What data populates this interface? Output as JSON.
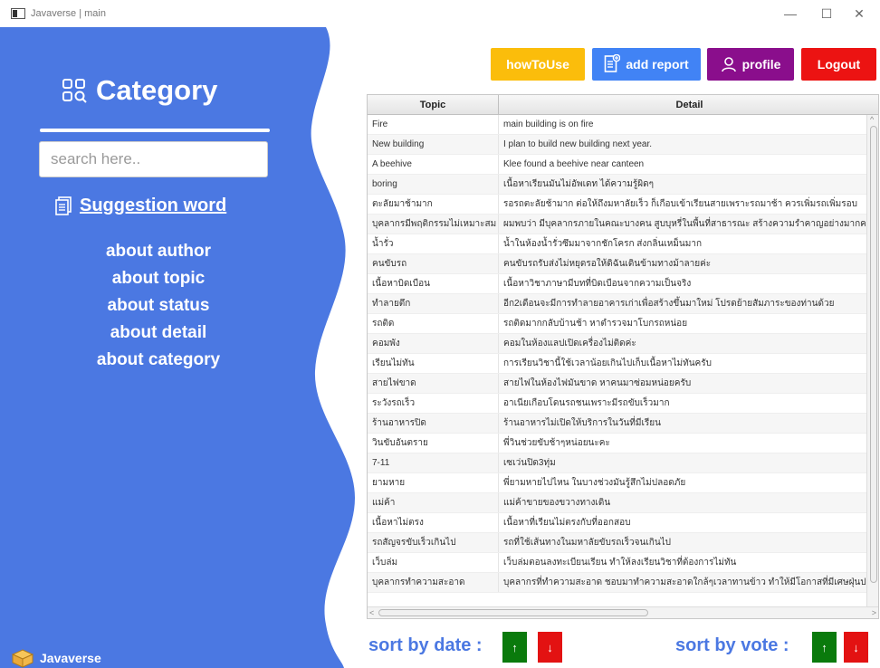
{
  "window": {
    "title": "Javaverse | main",
    "min_glyph": "—",
    "max_glyph": "☐",
    "close_glyph": "✕"
  },
  "sidebar": {
    "bg_color": "#4b78e2",
    "category_title": "Category",
    "search_placeholder": "search here..",
    "suggestion_title": "Suggestion word",
    "about_items": [
      "about author",
      "about topic",
      "about status",
      "about detail",
      "about category"
    ],
    "brand": "Javaverse"
  },
  "toolbar": {
    "howto_label": "howToUse",
    "add_report_label": "add report",
    "profile_label": "profile",
    "logout_label": "Logout",
    "colors": {
      "howto": "#fbbd0b",
      "add_report": "#4183f5",
      "profile": "#8a0e8c",
      "logout": "#ec1312"
    }
  },
  "table": {
    "headers": [
      "Topic",
      "Detail"
    ],
    "rows": [
      [
        "Fire",
        "main building is on fire"
      ],
      [
        "New building",
        "I plan to build new building next year."
      ],
      [
        "A beehive",
        "Klee found a beehive near canteen"
      ],
      [
        "boring",
        "เนื้อหาเรียนมันไม่อัพเดท ได้ความรู้ผิดๆ"
      ],
      [
        "ตะลัยมาช้ามาก",
        "รอรถตะลัยช้ามาก ต่อให้ถึงมหาลัยเร็ว ก็เกือบเข้าเรียนสายเพราะรถมาช้า ควรเพิ่มรถเพิ่มรอบ"
      ],
      [
        "บุคลากรมีพฤติกรรมไม่เหมาะสม",
        "ผมพบว่า มีบุคลากรภายในคณะบางคน สูบบุหรี่ในพื้นที่สาธารณะ สร้างความรำคาญอย่างมากครับ"
      ],
      [
        "น้ำรั่ว",
        "น้ำในห้องน้ำรั่วซึมมาจากชักโครก ส่งกลิ่นเหม็นมาก"
      ],
      [
        "คนขับรถ",
        "คนขับรถรับส่งไม่หยุดรอให้ดิฉันเดินข้ามทางม้าลายค่ะ"
      ],
      [
        "เนื้อหาบิดเบือน",
        "เนื้อหาวิชาภาษามีบทที่บิดเบือนจากความเป็นจริง"
      ],
      [
        "ทำลายตึก",
        "อีก2เดือนจะมีการทำลายอาคารเก่าเพื่อสร้างขึ้นมาใหม่ โปรดย้ายสัมภาระของท่านด้วย"
      ],
      [
        "รถติด",
        "รถติดมากกลับบ้านช้า หาตำรวจมาโบกรถหน่อย"
      ],
      [
        "คอมพัง",
        "คอมในห้องแลปเปิดเครื่องไม่ติดค่ะ"
      ],
      [
        "เรียนไม่ทัน",
        "การเรียนวิชานี้ใช้เวลาน้อยเกินไปเก็บเนื้อหาไม่ทันครับ"
      ],
      [
        "สายไฟขาด",
        "สายไฟในห้องไฟมันขาด หาคนมาซ่อมหน่อยครับ"
      ],
      [
        "ระวังรถเร็ว",
        "อาเนียเกือบโดนรถชนเพราะมีรถขับเร็วมาก"
      ],
      [
        "ร้านอาหารปิด",
        "ร้านอาหารไม่เปิดให้บริการในวันที่มีเรียน"
      ],
      [
        "วินขับอันตราย",
        "พี่วินช่วยขับช้าๆหน่อยนะคะ"
      ],
      [
        "7-11",
        "เซเว่นปิด3ทุ่ม"
      ],
      [
        "ยามหาย",
        "พี่ยามหายไปไหน ในบางช่วงมันรู้สึกไม่ปลอดภัย"
      ],
      [
        "แม่ค้า",
        "แม่ค้าขายของขวางทางเดิน"
      ],
      [
        "เนื้อหาไม่ตรง",
        "เนื้อหาที่เรียนไม่ตรงกับที่ออกสอบ"
      ],
      [
        "รถสัญจรขับเร็วเกินไป",
        "รถที่ใช้เส้นทางในมหาลัยขับรถเร็วจนเกินไป"
      ],
      [
        "เว็บล่ม",
        "เว็บล่มตอนลงทะเบียนเรียน ทำให้ลงเรียนวิชาที่ต้องการไม่ทัน"
      ],
      [
        "บุคลากรทำความสะอาด",
        "บุคลากรที่ทำความสะอาด ชอบมาทำความสะอาดใกล้ๆเวลาทานข้าว ทำให้มีโอกาสที่มีเศษฝุ่นปะปน"
      ]
    ]
  },
  "sort": {
    "date_label": "sort by date :",
    "vote_label": "sort by vote :",
    "up_glyph": "↑",
    "down_glyph": "↓"
  }
}
